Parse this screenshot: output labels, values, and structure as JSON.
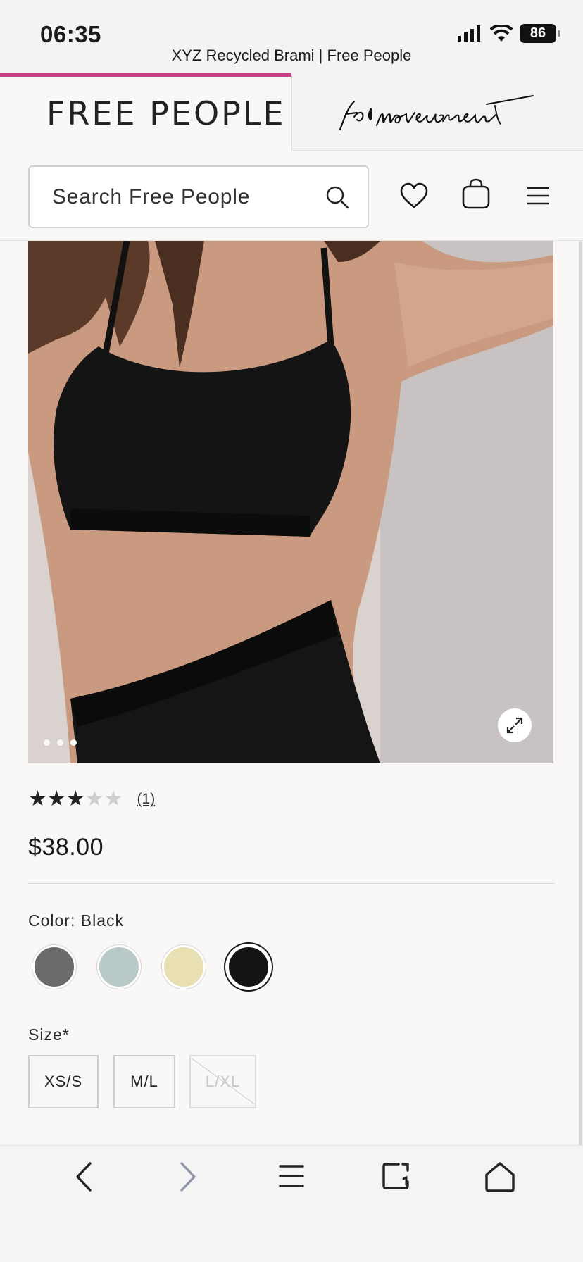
{
  "status_bar": {
    "time": "06:35",
    "battery": "86",
    "page_title": "XYZ Recycled Brami | Free People"
  },
  "header": {
    "brand": "FREE PEOPLE",
    "movement_logo_text": "fp movement"
  },
  "search": {
    "placeholder": "Search Free People"
  },
  "product": {
    "rating": 3,
    "rating_max": 5,
    "review_count": "(1)",
    "price": "$38.00",
    "color_label": "Color: Black",
    "colors": [
      {
        "name": "Charcoal",
        "hex": "#6a6a6a"
      },
      {
        "name": "Light Blue",
        "hex": "#b9c9c8"
      },
      {
        "name": "Cream",
        "hex": "#e8dfb3"
      },
      {
        "name": "Black",
        "hex": "#141414",
        "selected": true
      }
    ],
    "size_label": "Size*",
    "sizes": [
      {
        "label": "XS/S",
        "available": true
      },
      {
        "label": "M/L",
        "available": true
      },
      {
        "label": "L/XL",
        "available": false
      }
    ],
    "image_dots": 3
  },
  "colors": {
    "accent": "#c43f86",
    "text": "#1b1b1b",
    "background": "#faf8f7"
  },
  "toolbar": {
    "icons": [
      "back-icon",
      "forward-icon",
      "menu-icon",
      "tabs-icon",
      "home-icon"
    ]
  }
}
